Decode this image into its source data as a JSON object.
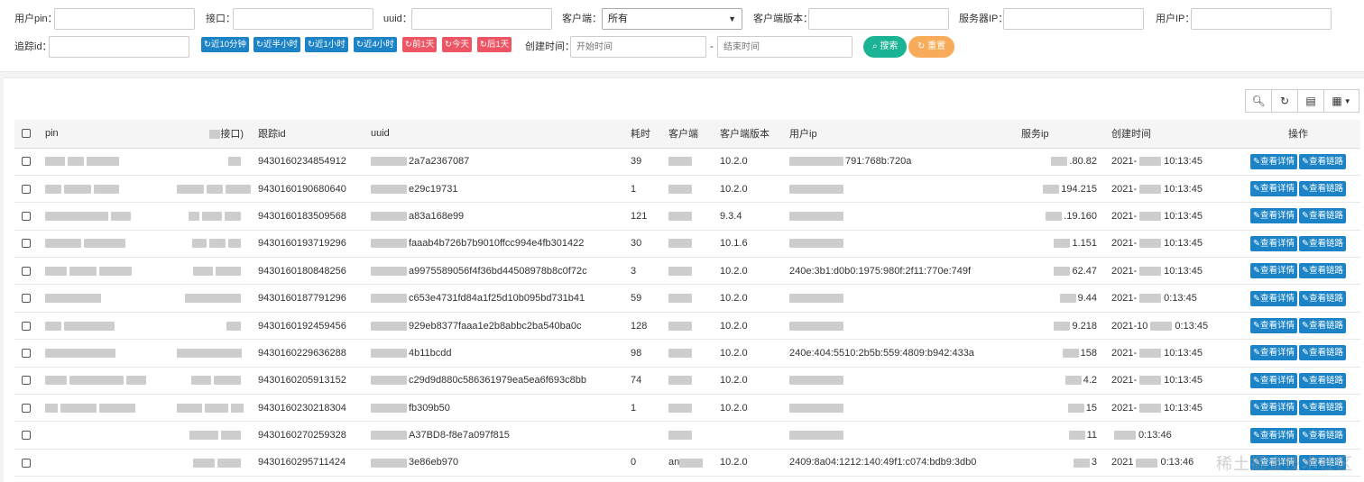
{
  "filters": {
    "user_pin_label": "用户pin：",
    "api_label": "接口：",
    "uuid_label": "uuid：",
    "client_label": "客户端：",
    "client_selected": "所有",
    "client_version_label": "客户端版本：",
    "server_ip_label": "服务器IP：",
    "user_ip_label": "用户IP：",
    "trace_id_label": "追踪id：",
    "quick": [
      "近10分钟",
      "近半小时",
      "近1小时",
      "近4小时",
      "前1天",
      "今天",
      "后1天"
    ],
    "created_time_label": "创建时间：",
    "start_placeholder": "开始时间",
    "range_sep": "-",
    "end_placeholder": "结束时间",
    "search_label": "搜索",
    "reset_label": "重置"
  },
  "table": {
    "headers": {
      "pin": "pin",
      "api": "接口)",
      "trace": "跟踪id",
      "uuid": "uuid",
      "cost": "耗时",
      "client": "客户端",
      "version": "客户端版本",
      "user_ip": "用户ip",
      "server_ip": "服务ip",
      "created": "创建时间",
      "ops": "操作"
    },
    "detail_label": "查看详情",
    "trace_label": "查看链路",
    "rows": [
      {
        "trace": "9430160234854912",
        "uuid": "2a7a2367087",
        "cost": "39",
        "client": "",
        "version": "10.2.0",
        "user_ip": "791:768b:720a",
        "server_ip": ".80.82",
        "created": "10:13:45",
        "date": "2021-"
      },
      {
        "trace": "9430160190680640",
        "uuid": "e29c19731",
        "cost": "1",
        "client": "",
        "version": "10.2.0",
        "user_ip": "",
        "server_ip": "194.215",
        "created": "10:13:45",
        "date": "2021-"
      },
      {
        "trace": "9430160183509568",
        "uuid": "a83a168e99",
        "cost": "121",
        "client": "",
        "version": "9.3.4",
        "user_ip": "",
        "server_ip": ".19.160",
        "created": "10:13:45",
        "date": "2021-"
      },
      {
        "trace": "9430160193719296",
        "uuid": "faaab4b726b7b9010ffcc994e4fb301422",
        "cost": "30",
        "client": "",
        "version": "10.1.6",
        "user_ip": "",
        "server_ip": "1.151",
        "created": "10:13:45",
        "date": "2021-"
      },
      {
        "trace": "9430160180848256",
        "uuid": "a9975589056f4f36bd44508978b8c0f72c",
        "cost": "3",
        "client": "",
        "version": "10.2.0",
        "user_ip": "240e:3b1:d0b0:1975:980f:2f11:770e:749f",
        "server_ip": "62.47",
        "created": "10:13:45",
        "date": "2021-"
      },
      {
        "trace": "9430160187791296",
        "uuid": "c653e4731fd84a1f25d10b095bd731b41",
        "cost": "59",
        "client": "",
        "version": "10.2.0",
        "user_ip": "",
        "server_ip": "9.44",
        "created": "0:13:45",
        "date": "2021-"
      },
      {
        "trace": "9430160192459456",
        "uuid": "929eb8377faaa1e2b8abbc2ba540ba0c",
        "cost": "128",
        "client": "",
        "version": "10.2.0",
        "user_ip": "",
        "server_ip": "9.218",
        "created": "0:13:45",
        "date": "2021-10"
      },
      {
        "trace": "9430160229636288",
        "uuid": "4b11bcdd",
        "cost": "98",
        "client": "",
        "version": "10.2.0",
        "user_ip": "240e:404:5510:2b5b:559:4809:b942:433a",
        "server_ip": "158",
        "created": "10:13:45",
        "date": "2021-"
      },
      {
        "trace": "9430160205913152",
        "uuid": "c29d9d880c586361979ea5ea6f693c8bb",
        "cost": "74",
        "client": "",
        "version": "10.2.0",
        "user_ip": "",
        "server_ip": "4.2",
        "created": "10:13:45",
        "date": "2021-"
      },
      {
        "trace": "9430160230218304",
        "uuid": "fb309b50",
        "cost": "1",
        "client": "",
        "version": "10.2.0",
        "user_ip": "",
        "server_ip": "15",
        "created": "10:13:45",
        "date": "2021-"
      },
      {
        "trace": "9430160270259328",
        "uuid": "A37BD8-f8e7a097f815",
        "cost": "",
        "client": "",
        "version": "",
        "user_ip": "",
        "server_ip": "11",
        "created": "0:13:46",
        "date": ""
      },
      {
        "trace": "9430160295711424",
        "uuid": "3e86eb970",
        "cost": "0",
        "client": "an",
        "version": "10.2.0",
        "user_ip": "2409:8a04:1212:140:49f1:c074:bdb9:3db0",
        "server_ip": "3",
        "created": "0:13:46",
        "date": "2021"
      }
    ]
  },
  "watermark": "稀土掘金技术社区"
}
